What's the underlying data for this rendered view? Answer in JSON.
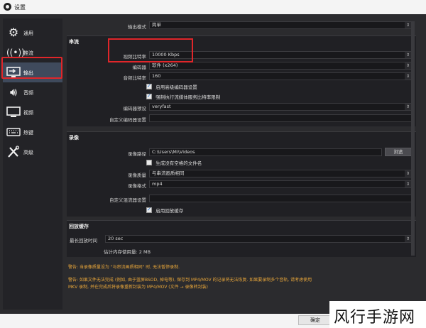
{
  "window": {
    "title": "设置"
  },
  "sidebar": {
    "items": [
      {
        "label": "通用",
        "icon": "gear-icon"
      },
      {
        "label": "推流",
        "icon": "antenna-icon"
      },
      {
        "label": "输出",
        "icon": "monitor-arrow-icon",
        "active": true
      },
      {
        "label": "音频",
        "icon": "speaker-icon"
      },
      {
        "label": "视频",
        "icon": "monitor-icon"
      },
      {
        "label": "热键",
        "icon": "keyboard-icon"
      },
      {
        "label": "高级",
        "icon": "tools-icon"
      }
    ]
  },
  "output_mode": {
    "label": "输出模式",
    "value": "简单"
  },
  "streaming": {
    "title": "串流",
    "video_bitrate": {
      "label": "视频比特率",
      "value": "10000 Kbps"
    },
    "encoder": {
      "label": "编码器",
      "value": "软件 (x264)"
    },
    "audio_bitrate": {
      "label": "音频比特率",
      "value": "160"
    },
    "enable_advanced": {
      "label": "启用高级编码器设置",
      "checked": true
    },
    "enforce_limits": {
      "label": "强制执行流媒体服务比特率限制",
      "checked": true
    },
    "preset": {
      "label": "编码器预设",
      "value": "veryfast"
    },
    "custom_settings": {
      "label": "自定义编码器设置",
      "value": ""
    }
  },
  "recording": {
    "title": "录像",
    "path": {
      "label": "录像路径",
      "value": "C:\\Users\\Mi\\Videos",
      "browse": "浏览"
    },
    "no_space_filename": {
      "label": "生成没有空格的文件名",
      "checked": false
    },
    "quality": {
      "label": "录像质量",
      "value": "与串流画质相同"
    },
    "format": {
      "label": "录像格式",
      "value": "mp4"
    },
    "muxer": {
      "label": "自定义混流器设置",
      "value": ""
    },
    "replay_buffer": {
      "label": "启用回放缓存",
      "checked": true
    }
  },
  "replay": {
    "title": "回放缓存",
    "max_time": {
      "label": "最长回放时间",
      "value": "20 sec"
    },
    "memory": {
      "label": "估计内存使用量: 2 MB"
    }
  },
  "warnings": {
    "line1": "警告: 当录像质量设为 \"与串流画质相同\" 时, 无法暂停录制.",
    "line2": "警告: 如果文件无法完成 (例如, 由于蓝屏BSOD, 掉电等), 保存到 MP4/MOV 的记录将无法恢复. 如果要录制多个音轨, 请考虑使用",
    "line3": "MKV 录制, 并在完成后将录像重新封装为 MP4/MOV (文件 → 录像转封装)"
  },
  "footer": {
    "ok": "确定",
    "cancel": "取消",
    "apply": "应用"
  },
  "watermark": "风行手游网"
}
